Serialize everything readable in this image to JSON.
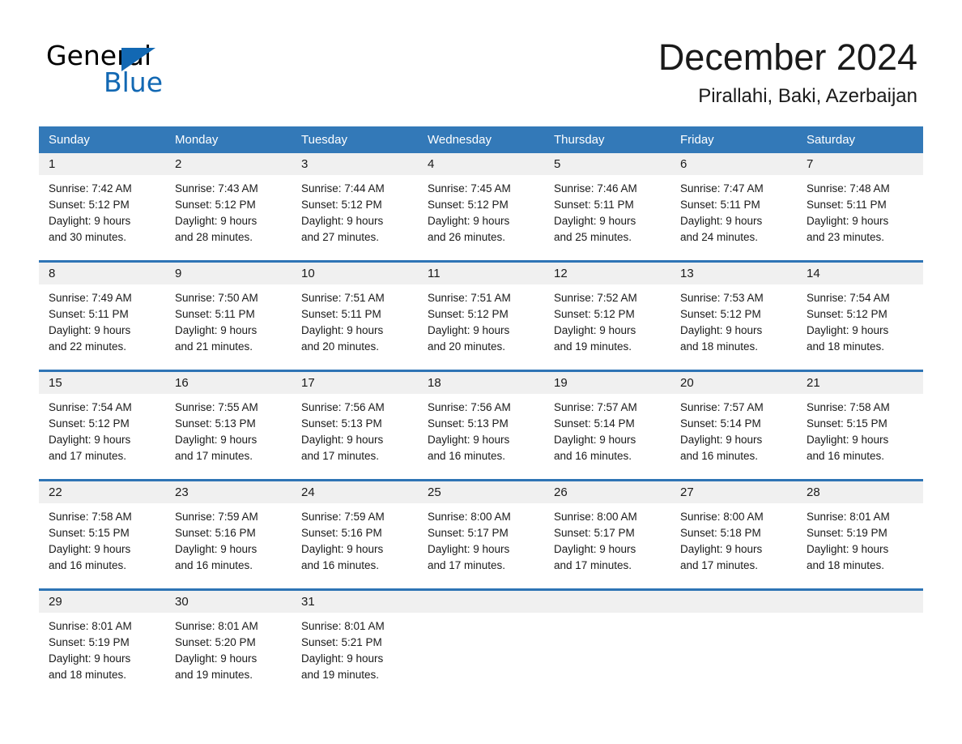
{
  "brand": {
    "name_part1": "General",
    "name_part2": "Blue",
    "logo_icon": "triangle-logo-icon",
    "accent_color": "#1268b3"
  },
  "header": {
    "month_title": "December 2024",
    "location": "Pirallahi, Baki, Azerbaijan"
  },
  "calendar": {
    "header_background_color": "#3379b8",
    "row_border_color": "#2e74b5",
    "daynum_band_color": "#f0f0f0",
    "weekday_headers": [
      "Sunday",
      "Monday",
      "Tuesday",
      "Wednesday",
      "Thursday",
      "Friday",
      "Saturday"
    ],
    "weeks": [
      [
        {
          "day": "1",
          "sunrise": "Sunrise: 7:42 AM",
          "sunset": "Sunset: 5:12 PM",
          "daylight_line1": "Daylight: 9 hours",
          "daylight_line2": "and 30 minutes."
        },
        {
          "day": "2",
          "sunrise": "Sunrise: 7:43 AM",
          "sunset": "Sunset: 5:12 PM",
          "daylight_line1": "Daylight: 9 hours",
          "daylight_line2": "and 28 minutes."
        },
        {
          "day": "3",
          "sunrise": "Sunrise: 7:44 AM",
          "sunset": "Sunset: 5:12 PM",
          "daylight_line1": "Daylight: 9 hours",
          "daylight_line2": "and 27 minutes."
        },
        {
          "day": "4",
          "sunrise": "Sunrise: 7:45 AM",
          "sunset": "Sunset: 5:12 PM",
          "daylight_line1": "Daylight: 9 hours",
          "daylight_line2": "and 26 minutes."
        },
        {
          "day": "5",
          "sunrise": "Sunrise: 7:46 AM",
          "sunset": "Sunset: 5:11 PM",
          "daylight_line1": "Daylight: 9 hours",
          "daylight_line2": "and 25 minutes."
        },
        {
          "day": "6",
          "sunrise": "Sunrise: 7:47 AM",
          "sunset": "Sunset: 5:11 PM",
          "daylight_line1": "Daylight: 9 hours",
          "daylight_line2": "and 24 minutes."
        },
        {
          "day": "7",
          "sunrise": "Sunrise: 7:48 AM",
          "sunset": "Sunset: 5:11 PM",
          "daylight_line1": "Daylight: 9 hours",
          "daylight_line2": "and 23 minutes."
        }
      ],
      [
        {
          "day": "8",
          "sunrise": "Sunrise: 7:49 AM",
          "sunset": "Sunset: 5:11 PM",
          "daylight_line1": "Daylight: 9 hours",
          "daylight_line2": "and 22 minutes."
        },
        {
          "day": "9",
          "sunrise": "Sunrise: 7:50 AM",
          "sunset": "Sunset: 5:11 PM",
          "daylight_line1": "Daylight: 9 hours",
          "daylight_line2": "and 21 minutes."
        },
        {
          "day": "10",
          "sunrise": "Sunrise: 7:51 AM",
          "sunset": "Sunset: 5:11 PM",
          "daylight_line1": "Daylight: 9 hours",
          "daylight_line2": "and 20 minutes."
        },
        {
          "day": "11",
          "sunrise": "Sunrise: 7:51 AM",
          "sunset": "Sunset: 5:12 PM",
          "daylight_line1": "Daylight: 9 hours",
          "daylight_line2": "and 20 minutes."
        },
        {
          "day": "12",
          "sunrise": "Sunrise: 7:52 AM",
          "sunset": "Sunset: 5:12 PM",
          "daylight_line1": "Daylight: 9 hours",
          "daylight_line2": "and 19 minutes."
        },
        {
          "day": "13",
          "sunrise": "Sunrise: 7:53 AM",
          "sunset": "Sunset: 5:12 PM",
          "daylight_line1": "Daylight: 9 hours",
          "daylight_line2": "and 18 minutes."
        },
        {
          "day": "14",
          "sunrise": "Sunrise: 7:54 AM",
          "sunset": "Sunset: 5:12 PM",
          "daylight_line1": "Daylight: 9 hours",
          "daylight_line2": "and 18 minutes."
        }
      ],
      [
        {
          "day": "15",
          "sunrise": "Sunrise: 7:54 AM",
          "sunset": "Sunset: 5:12 PM",
          "daylight_line1": "Daylight: 9 hours",
          "daylight_line2": "and 17 minutes."
        },
        {
          "day": "16",
          "sunrise": "Sunrise: 7:55 AM",
          "sunset": "Sunset: 5:13 PM",
          "daylight_line1": "Daylight: 9 hours",
          "daylight_line2": "and 17 minutes."
        },
        {
          "day": "17",
          "sunrise": "Sunrise: 7:56 AM",
          "sunset": "Sunset: 5:13 PM",
          "daylight_line1": "Daylight: 9 hours",
          "daylight_line2": "and 17 minutes."
        },
        {
          "day": "18",
          "sunrise": "Sunrise: 7:56 AM",
          "sunset": "Sunset: 5:13 PM",
          "daylight_line1": "Daylight: 9 hours",
          "daylight_line2": "and 16 minutes."
        },
        {
          "day": "19",
          "sunrise": "Sunrise: 7:57 AM",
          "sunset": "Sunset: 5:14 PM",
          "daylight_line1": "Daylight: 9 hours",
          "daylight_line2": "and 16 minutes."
        },
        {
          "day": "20",
          "sunrise": "Sunrise: 7:57 AM",
          "sunset": "Sunset: 5:14 PM",
          "daylight_line1": "Daylight: 9 hours",
          "daylight_line2": "and 16 minutes."
        },
        {
          "day": "21",
          "sunrise": "Sunrise: 7:58 AM",
          "sunset": "Sunset: 5:15 PM",
          "daylight_line1": "Daylight: 9 hours",
          "daylight_line2": "and 16 minutes."
        }
      ],
      [
        {
          "day": "22",
          "sunrise": "Sunrise: 7:58 AM",
          "sunset": "Sunset: 5:15 PM",
          "daylight_line1": "Daylight: 9 hours",
          "daylight_line2": "and 16 minutes."
        },
        {
          "day": "23",
          "sunrise": "Sunrise: 7:59 AM",
          "sunset": "Sunset: 5:16 PM",
          "daylight_line1": "Daylight: 9 hours",
          "daylight_line2": "and 16 minutes."
        },
        {
          "day": "24",
          "sunrise": "Sunrise: 7:59 AM",
          "sunset": "Sunset: 5:16 PM",
          "daylight_line1": "Daylight: 9 hours",
          "daylight_line2": "and 16 minutes."
        },
        {
          "day": "25",
          "sunrise": "Sunrise: 8:00 AM",
          "sunset": "Sunset: 5:17 PM",
          "daylight_line1": "Daylight: 9 hours",
          "daylight_line2": "and 17 minutes."
        },
        {
          "day": "26",
          "sunrise": "Sunrise: 8:00 AM",
          "sunset": "Sunset: 5:17 PM",
          "daylight_line1": "Daylight: 9 hours",
          "daylight_line2": "and 17 minutes."
        },
        {
          "day": "27",
          "sunrise": "Sunrise: 8:00 AM",
          "sunset": "Sunset: 5:18 PM",
          "daylight_line1": "Daylight: 9 hours",
          "daylight_line2": "and 17 minutes."
        },
        {
          "day": "28",
          "sunrise": "Sunrise: 8:01 AM",
          "sunset": "Sunset: 5:19 PM",
          "daylight_line1": "Daylight: 9 hours",
          "daylight_line2": "and 18 minutes."
        }
      ],
      [
        {
          "day": "29",
          "sunrise": "Sunrise: 8:01 AM",
          "sunset": "Sunset: 5:19 PM",
          "daylight_line1": "Daylight: 9 hours",
          "daylight_line2": "and 18 minutes."
        },
        {
          "day": "30",
          "sunrise": "Sunrise: 8:01 AM",
          "sunset": "Sunset: 5:20 PM",
          "daylight_line1": "Daylight: 9 hours",
          "daylight_line2": "and 19 minutes."
        },
        {
          "day": "31",
          "sunrise": "Sunrise: 8:01 AM",
          "sunset": "Sunset: 5:21 PM",
          "daylight_line1": "Daylight: 9 hours",
          "daylight_line2": "and 19 minutes."
        },
        {
          "day": "",
          "sunrise": "",
          "sunset": "",
          "daylight_line1": "",
          "daylight_line2": ""
        },
        {
          "day": "",
          "sunrise": "",
          "sunset": "",
          "daylight_line1": "",
          "daylight_line2": ""
        },
        {
          "day": "",
          "sunrise": "",
          "sunset": "",
          "daylight_line1": "",
          "daylight_line2": ""
        },
        {
          "day": "",
          "sunrise": "",
          "sunset": "",
          "daylight_line1": "",
          "daylight_line2": ""
        }
      ]
    ]
  }
}
